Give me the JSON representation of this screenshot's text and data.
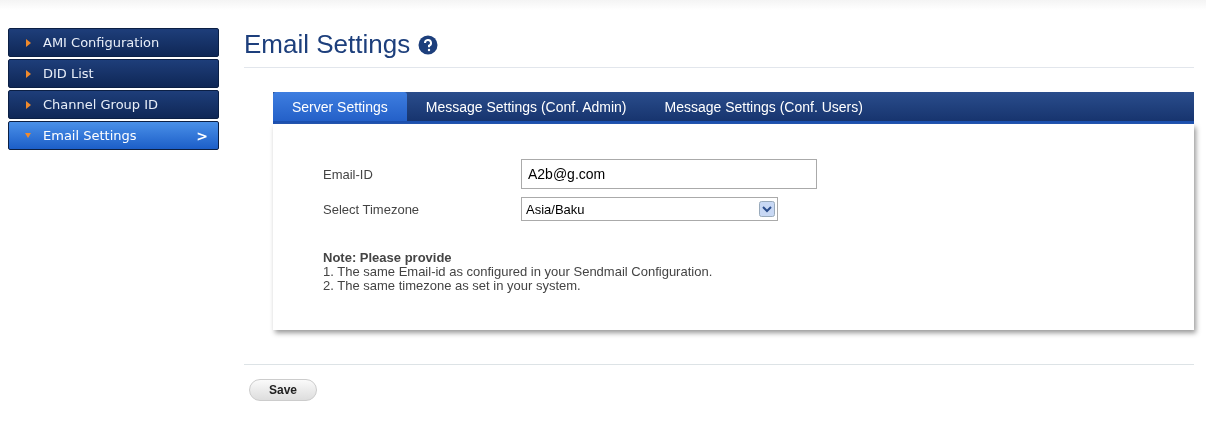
{
  "sidebar": {
    "items": [
      {
        "label": "AMI Configuration",
        "selected": false
      },
      {
        "label": "DID List",
        "selected": false
      },
      {
        "label": "Channel Group ID",
        "selected": false
      },
      {
        "label": "Email Settings",
        "selected": true,
        "chevron": ">"
      }
    ]
  },
  "page": {
    "title": "Email Settings"
  },
  "tabs": [
    {
      "label": "Server Settings",
      "selected": true
    },
    {
      "label": "Message Settings (Conf. Admin)",
      "selected": false
    },
    {
      "label": "Message Settings (Conf. Users)",
      "selected": false
    }
  ],
  "form": {
    "fields": [
      {
        "kind": "text",
        "label": "Email-ID",
        "value": "A2b@g.com"
      },
      {
        "kind": "select",
        "label": "Select Timezone",
        "value": "Asia/Baku"
      }
    ]
  },
  "note": {
    "heading": "Note: Please provide",
    "lines": [
      "1. The same Email-id as configured in your Sendmail Configuration.",
      "2. The same timezone as set in your system."
    ]
  },
  "buttons": [
    "Save"
  ]
}
